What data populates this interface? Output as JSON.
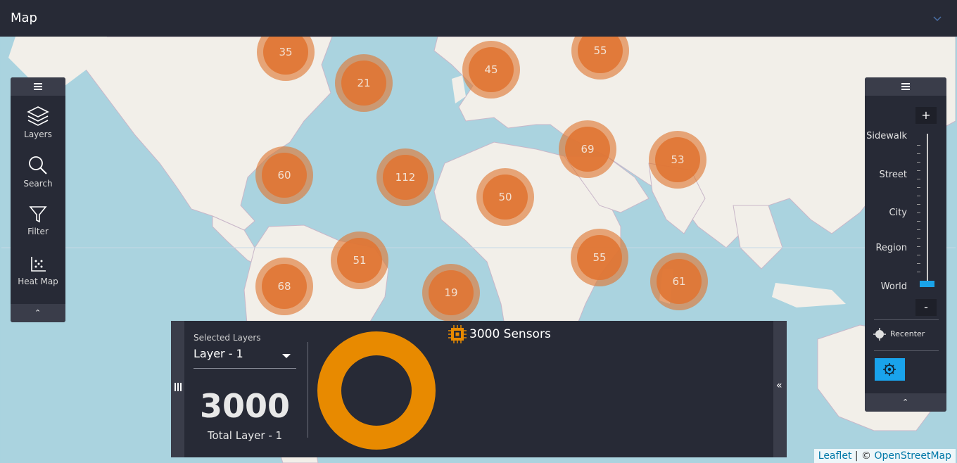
{
  "header": {
    "title": "Map",
    "collapse_icon": "chevron-down-icon"
  },
  "map": {
    "clusters": [
      {
        "label": "35"
      },
      {
        "label": "21"
      },
      {
        "label": "45"
      },
      {
        "label": "55"
      },
      {
        "label": "60"
      },
      {
        "label": "112"
      },
      {
        "label": "50"
      },
      {
        "label": "69"
      },
      {
        "label": "53"
      },
      {
        "label": "51"
      },
      {
        "label": "68"
      },
      {
        "label": "19"
      },
      {
        "label": "55"
      },
      {
        "label": "61"
      }
    ],
    "cluster_color": "#e07432",
    "attribution": {
      "leaflet": "Leaflet",
      "sep": " | © ",
      "osm": "OpenStreetMap"
    }
  },
  "left_toolbar": {
    "tools": [
      {
        "label": "Layers",
        "icon": "layers-icon"
      },
      {
        "label": "Search",
        "icon": "search-icon"
      },
      {
        "label": "Filter",
        "icon": "filter-icon"
      },
      {
        "label": "Heat Map",
        "icon": "heat-map-icon"
      }
    ]
  },
  "zoom_panel": {
    "plus": "+",
    "minus": "-",
    "levels": [
      "Sidewalk",
      "Street",
      "City",
      "Region",
      "World"
    ],
    "current_level": "World",
    "recenter_label": "Recenter",
    "accent": "#1aa3e8"
  },
  "bottom_panel": {
    "selected_layers_label": "Selected Layers",
    "selected_layer": "Layer - 1",
    "count": "3000",
    "total_label": "Total Layer - 1",
    "sensors_label": "3000 Sensors",
    "donut_color": "#e88a00"
  }
}
